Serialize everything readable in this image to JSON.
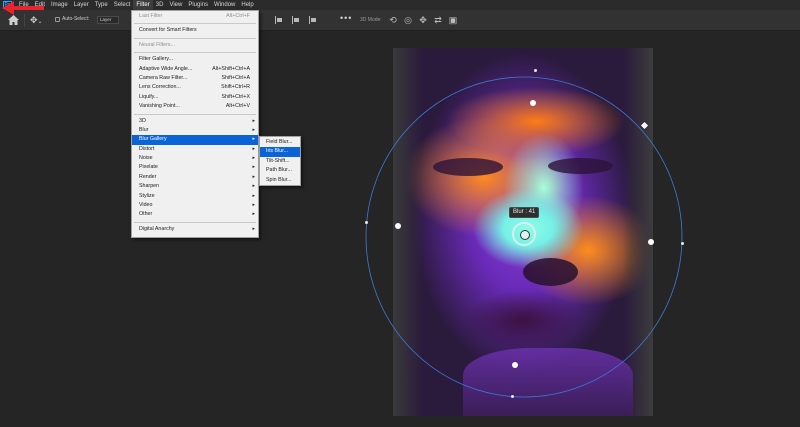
{
  "menubar": {
    "logo": "Ps",
    "items": [
      "File",
      "Edit",
      "Image",
      "Layer",
      "Type",
      "Select",
      "Filter",
      "3D",
      "View",
      "Plugins",
      "Window",
      "Help"
    ],
    "active_index": 6
  },
  "options": {
    "auto_select_label": "Auto-Select:",
    "layer_value": "Layer",
    "mode_3d_label": "3D Mode:"
  },
  "filter_menu": {
    "items": [
      {
        "label": "Last Filter",
        "shortcut": "Alt+Ctrl+F",
        "disabled": true
      },
      {
        "separator": true
      },
      {
        "label": "Convert for Smart Filters",
        "shortcut": ""
      },
      {
        "separator": true
      },
      {
        "label": "Neural Filters...",
        "shortcut": "",
        "disabled": true
      },
      {
        "separator": true
      },
      {
        "label": "Filter Gallery...",
        "shortcut": ""
      },
      {
        "label": "Adaptive Wide Angle...",
        "shortcut": "Alt+Shift+Ctrl+A"
      },
      {
        "label": "Camera Raw Filter...",
        "shortcut": "Shift+Ctrl+A"
      },
      {
        "label": "Lens Correction...",
        "shortcut": "Shift+Ctrl+R"
      },
      {
        "label": "Liquify...",
        "shortcut": "Shift+Ctrl+X"
      },
      {
        "label": "Vanishing Point...",
        "shortcut": "Alt+Ctrl+V"
      },
      {
        "separator": true
      },
      {
        "label": "3D",
        "submenu": true
      },
      {
        "label": "Blur",
        "submenu": true
      },
      {
        "label": "Blur Gallery",
        "submenu": true,
        "highlighted": true
      },
      {
        "label": "Distort",
        "submenu": true
      },
      {
        "label": "Noise",
        "submenu": true
      },
      {
        "label": "Pixelate",
        "submenu": true
      },
      {
        "label": "Render",
        "submenu": true
      },
      {
        "label": "Sharpen",
        "submenu": true
      },
      {
        "label": "Stylize",
        "submenu": true
      },
      {
        "label": "Video",
        "submenu": true
      },
      {
        "label": "Other",
        "submenu": true
      },
      {
        "separator": true
      },
      {
        "label": "Digital Anarchy",
        "submenu": true
      }
    ]
  },
  "blur_gallery_submenu": {
    "items": [
      "Field Blur...",
      "Iris Blur...",
      "Tilt-Shift...",
      "Path Blur...",
      "Spin Blur..."
    ],
    "highlighted_index": 1
  },
  "canvas": {
    "blur_tooltip": "Blur :  41",
    "arrow_color": "#e8242c"
  }
}
